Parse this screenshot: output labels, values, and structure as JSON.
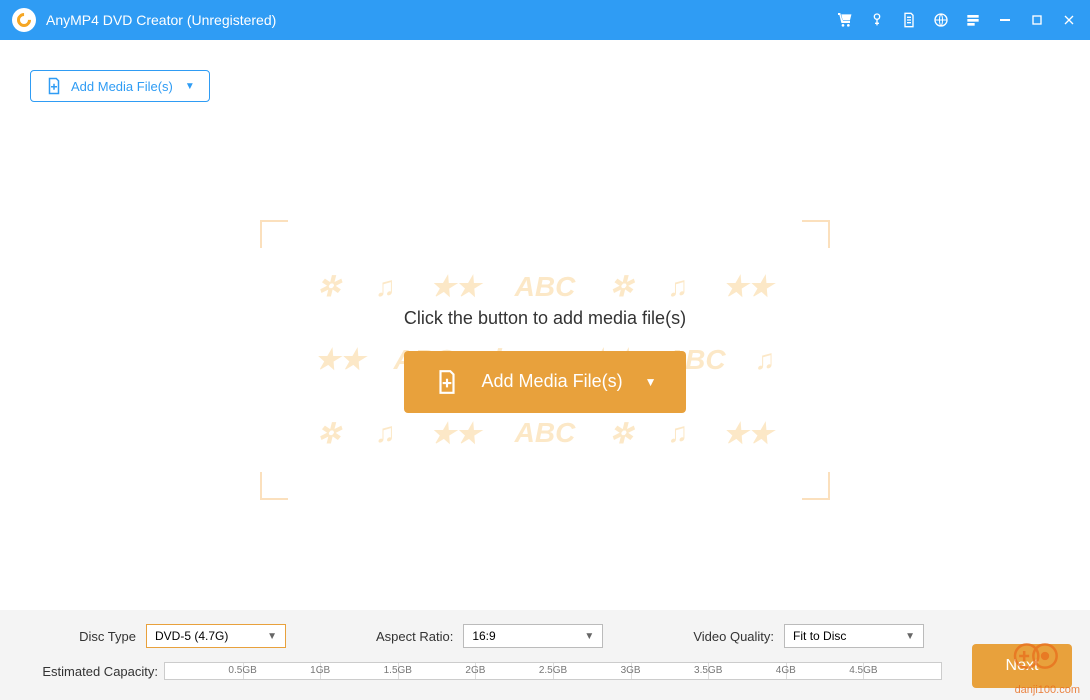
{
  "titlebar": {
    "title": "AnyMP4 DVD Creator (Unregistered)"
  },
  "toolbar": {
    "add_label": "Add Media File(s)"
  },
  "dropzone": {
    "hint": "Click the button to add media file(s)",
    "add_label": "Add Media File(s)",
    "bg_token": "ABC"
  },
  "bottom": {
    "disc_type_label": "Disc Type",
    "disc_type_value": "DVD-5 (4.7G)",
    "aspect_ratio_label": "Aspect Ratio:",
    "aspect_ratio_value": "16:9",
    "video_quality_label": "Video Quality:",
    "video_quality_value": "Fit to Disc",
    "estimated_capacity_label": "Estimated Capacity:",
    "ticks": [
      "0.5GB",
      "1GB",
      "1.5GB",
      "2GB",
      "2.5GB",
      "3GB",
      "3.5GB",
      "4GB",
      "4.5GB"
    ],
    "next_label": "Next"
  },
  "watermark": {
    "text": "danji100.com"
  }
}
